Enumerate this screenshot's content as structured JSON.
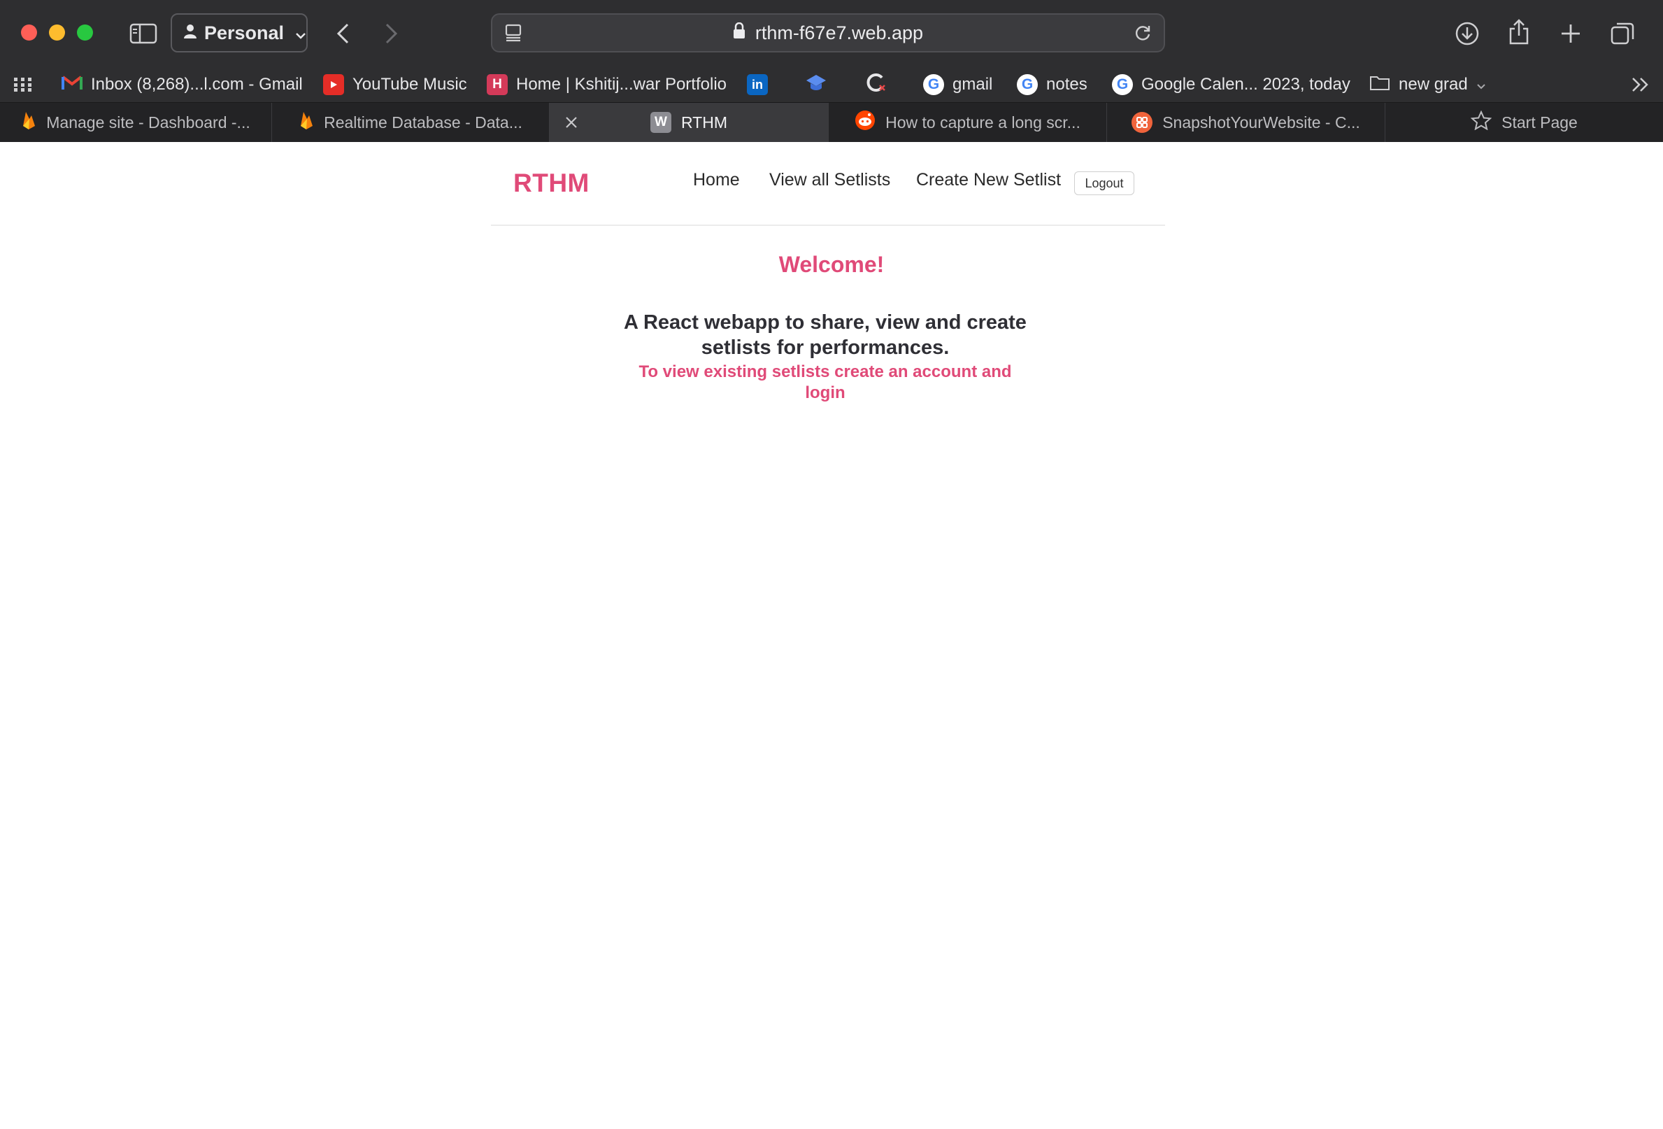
{
  "browser": {
    "profile": "Personal",
    "url": "rthm-f67e7.web.app",
    "bookmarks": [
      {
        "label": "Inbox (8,268)...l.com - Gmail",
        "icon": "gmail-icon"
      },
      {
        "label": "YouTube Music",
        "icon": "youtube-icon"
      },
      {
        "label": "Home | Kshitij...war Portfolio",
        "icon": "portfolio-icon",
        "letter": "H"
      },
      {
        "label": "",
        "icon": "linkedin-icon",
        "letter": "in"
      },
      {
        "label": "",
        "icon": "graduation-cap-icon"
      },
      {
        "label": "",
        "icon": "extension-icon"
      },
      {
        "label": "gmail",
        "icon": "google-icon",
        "letter": "G"
      },
      {
        "label": "notes",
        "icon": "google-icon",
        "letter": "G"
      },
      {
        "label": "Google Calen... 2023, today",
        "icon": "google-icon",
        "letter": "G"
      },
      {
        "label": "new grad",
        "icon": "folder-icon"
      }
    ],
    "tabs": [
      {
        "label": "Manage site - Dashboard -...",
        "icon": "firebase-icon"
      },
      {
        "label": "Realtime Database - Data...",
        "icon": "firebase-icon"
      },
      {
        "label": "RTHM",
        "icon": "w-icon",
        "letter": "W"
      },
      {
        "label": "How to capture a long scr...",
        "icon": "reddit-icon"
      },
      {
        "label": "SnapshotYourWebsite - C...",
        "icon": "snapshot-icon"
      },
      {
        "label": "Start Page",
        "icon": "star-icon"
      }
    ]
  },
  "site": {
    "brand": "RTHM",
    "nav": {
      "home": "Home",
      "view_all": "View all Setlists",
      "create": "Create New Setlist",
      "logout": "Logout"
    },
    "welcome": "Welcome!",
    "tagline": "A React webapp to share, view and create setlists for performances.",
    "hint": "To view existing setlists create an account and login"
  },
  "colors": {
    "accent": "#e04a78",
    "chrome": "#2e2e30",
    "tabbar": "#232325"
  }
}
